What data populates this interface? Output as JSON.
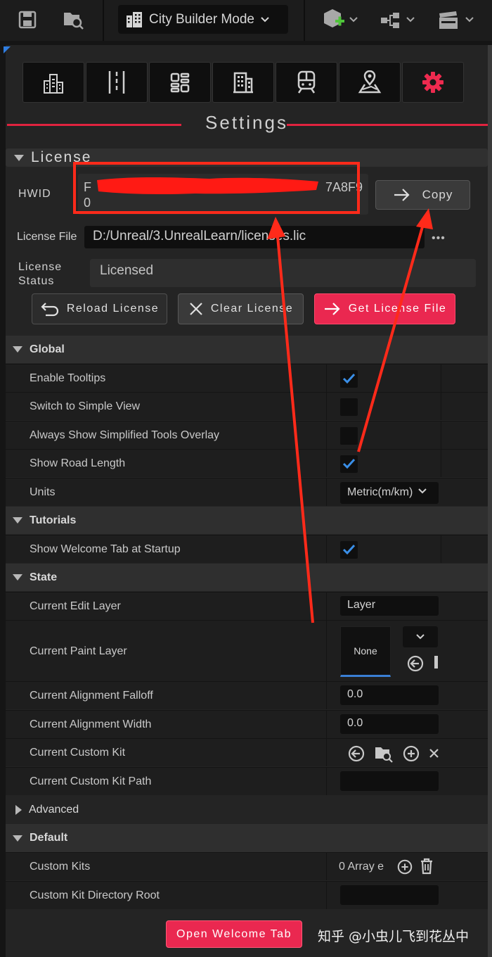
{
  "toolbar": {
    "mode_label": "City Builder Mode"
  },
  "panel": {
    "title": "Settings",
    "tabs": [
      "buildings-icon",
      "road-icon",
      "layout-icon",
      "office-icon",
      "train-icon",
      "map-icon",
      "gear-icon"
    ],
    "license": {
      "header": "License",
      "hwid_label": "HWID",
      "hwid_value_line1": "F",
      "hwid_value_tail": "7A8F9",
      "hwid_value_line2": "0",
      "copy_label": "Copy",
      "license_file_label": "License File",
      "license_file_value": "D:/Unreal/3.UnrealLearn/licenses.lic",
      "browse_label": "•••",
      "license_status_label_1": "License",
      "license_status_label_2": "Status",
      "license_status_value": "Licensed",
      "reload_label": "Reload License",
      "clear_label": "Clear License",
      "get_label": "Get License File"
    },
    "global": {
      "header": "Global",
      "enable_tooltips": "Enable Tooltips",
      "simple_view": "Switch to Simple View",
      "simplified_overlay": "Always Show Simplified Tools Overlay",
      "road_length": "Show Road Length",
      "units": "Units",
      "units_value": "Metric(m/km)"
    },
    "tutorials": {
      "header": "Tutorials",
      "welcome_tab": "Show Welcome Tab at Startup"
    },
    "state": {
      "header": "State",
      "edit_layer": "Current Edit Layer",
      "edit_layer_value": "Layer",
      "paint_layer": "Current Paint Layer",
      "paint_layer_value": "None",
      "alignment_falloff": "Current Alignment Falloff",
      "alignment_falloff_value": "0.0",
      "alignment_width": "Current Alignment Width",
      "alignment_width_value": "0.0",
      "custom_kit": "Current Custom Kit",
      "custom_kit_path": "Current Custom Kit Path"
    },
    "advanced": {
      "header": "Advanced"
    },
    "default": {
      "header": "Default",
      "custom_kits": "Custom Kits",
      "custom_kits_value": "0 Array e",
      "kit_dir_root": "Custom Kit Directory Root"
    },
    "open_welcome_label": "Open Welcome Tab"
  },
  "watermark": "知乎 @小虫儿飞到花丛中",
  "colors": {
    "accent": "#ea2850",
    "check": "#3a8fe8",
    "annotation": "#ff2a1a"
  }
}
